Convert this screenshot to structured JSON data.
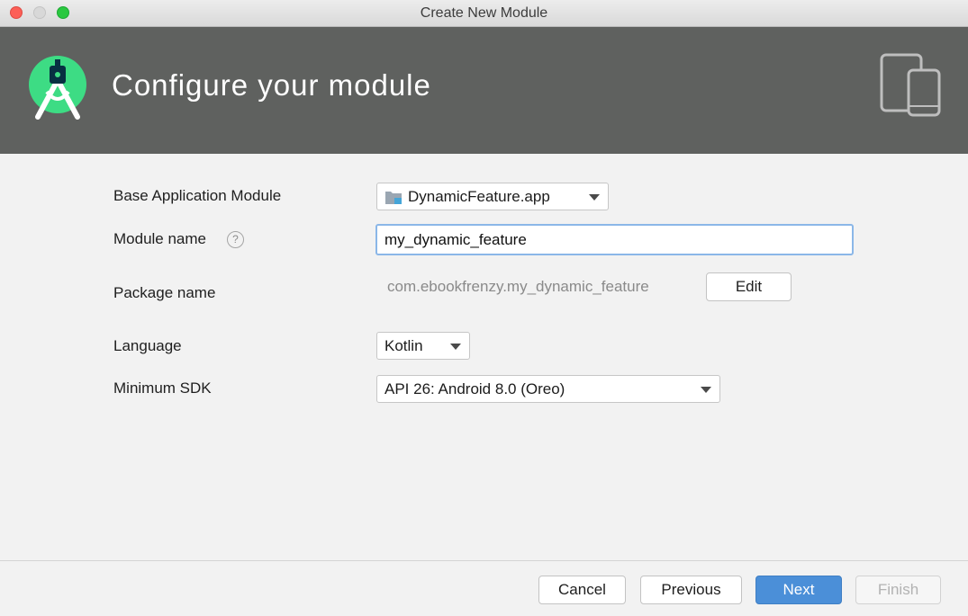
{
  "window": {
    "title": "Create New Module"
  },
  "header": {
    "title": "Configure your module",
    "logo_icon": "android-studio-logo-icon",
    "devices_icon": "tablet-phone-devices-icon"
  },
  "form": {
    "base_module": {
      "label": "Base Application Module",
      "value": "DynamicFeature.app",
      "icon": "module-folder-icon"
    },
    "module_name": {
      "label": "Module name",
      "value": "my_dynamic_feature",
      "help": "?"
    },
    "package_name": {
      "label": "Package name",
      "value": "com.ebookfrenzy.my_dynamic_feature",
      "edit_label": "Edit"
    },
    "language": {
      "label": "Language",
      "value": "Kotlin"
    },
    "min_sdk": {
      "label": "Minimum SDK",
      "value": "API 26: Android 8.0 (Oreo)"
    }
  },
  "footer": {
    "cancel_label": "Cancel",
    "previous_label": "Previous",
    "next_label": "Next",
    "finish_label": "Finish"
  },
  "colors": {
    "header_bg": "#5f615f",
    "primary_button": "#4b8fd8",
    "android_green": "#3ddc84",
    "android_navy": "#073042"
  }
}
